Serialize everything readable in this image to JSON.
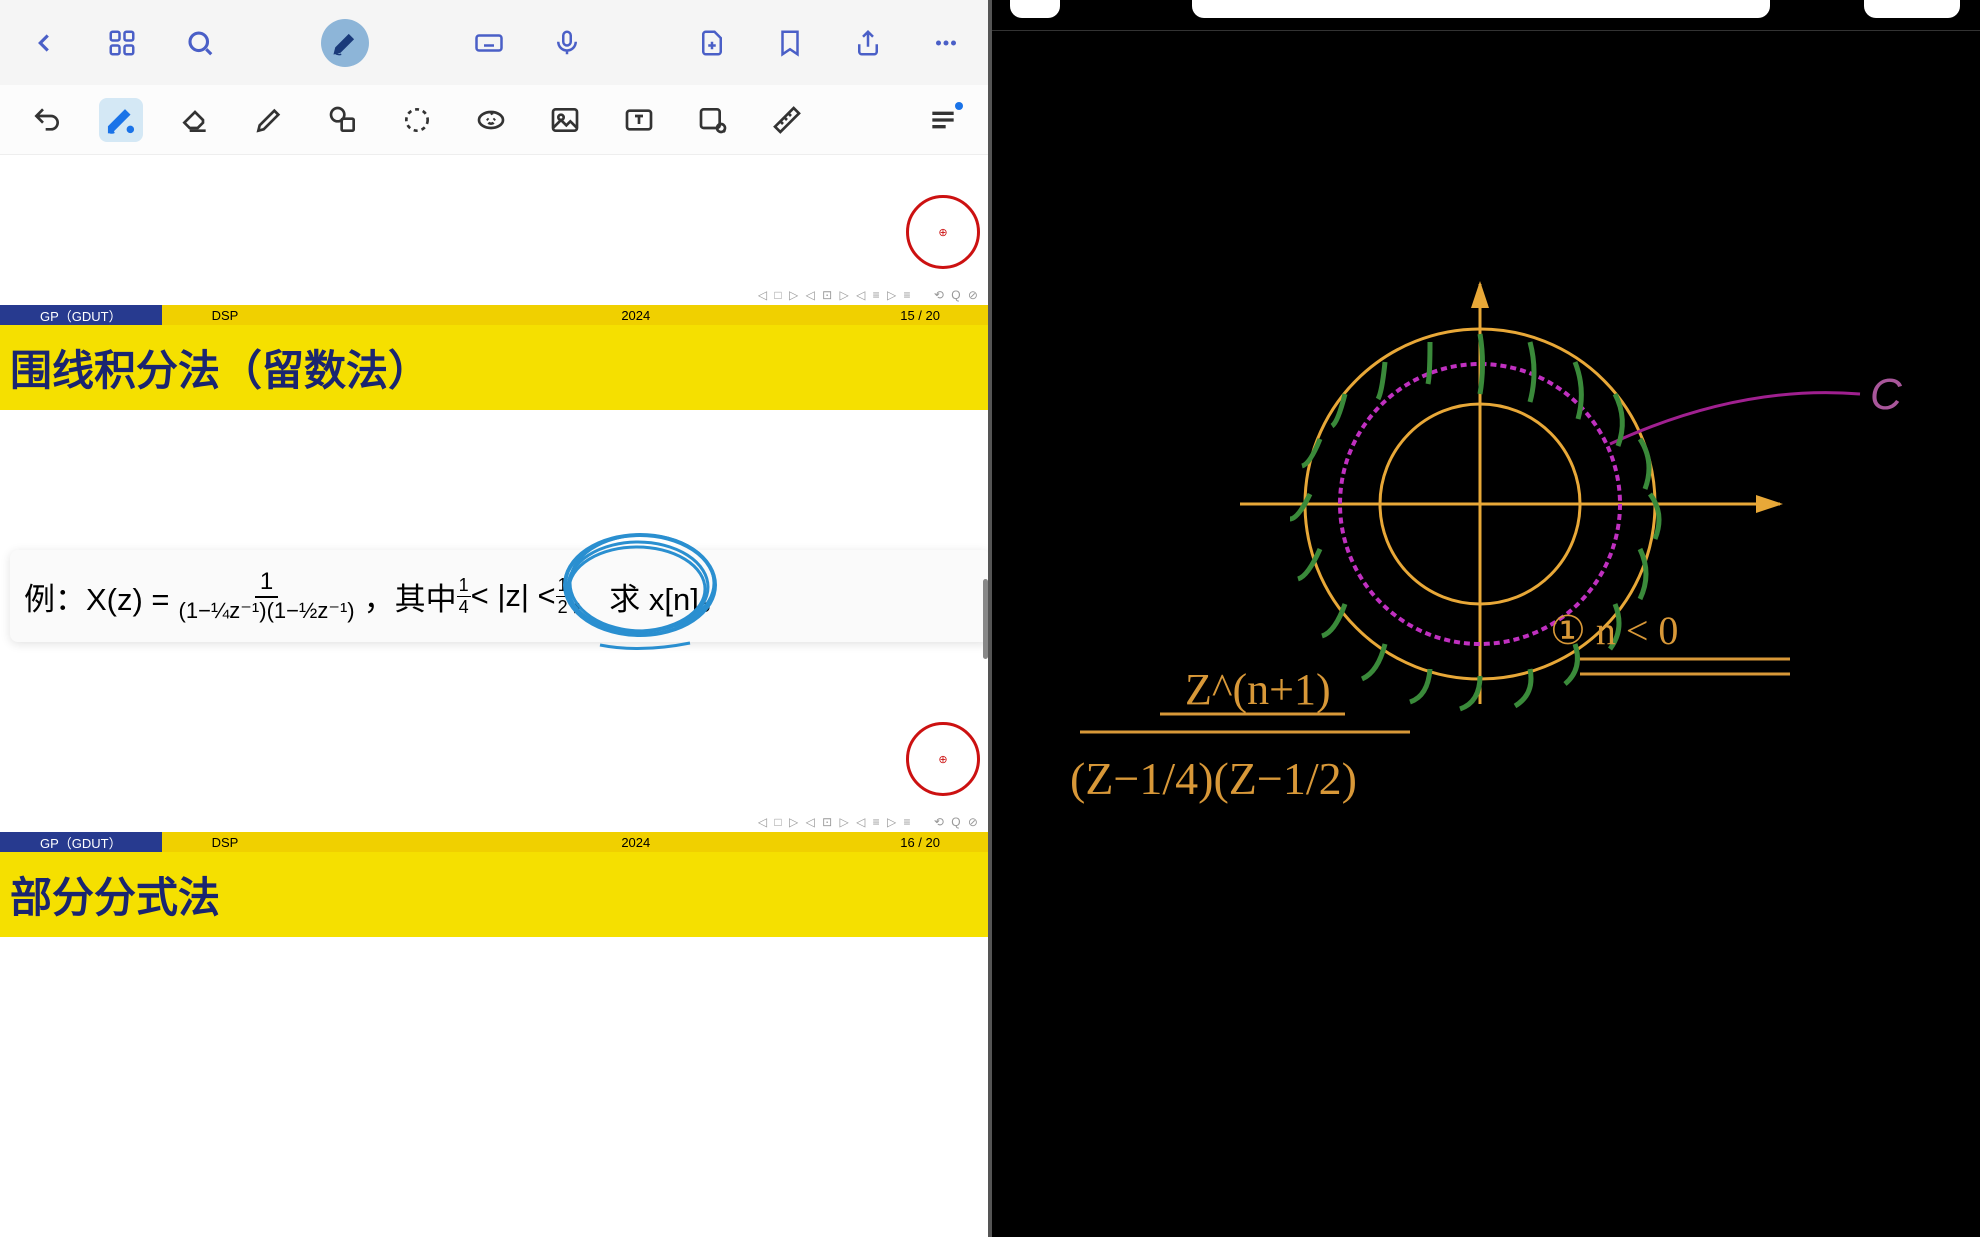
{
  "left": {
    "slide1": {
      "gp": "GP（GDUT）",
      "dsp": "DSP",
      "year": "2024",
      "page": "15 / 20"
    },
    "slide2": {
      "title": "围线积分法（留数法）",
      "gp": "GP（GDUT）",
      "dsp": "DSP",
      "year": "2024",
      "page": "16 / 20",
      "formula_prefix": "例：X(z) = ",
      "formula_num": "1",
      "formula_den": "(1−¼z⁻¹)(1−½z⁻¹)",
      "formula_mid": "，其中 ",
      "cond_left": "1",
      "cond_left_d": "4",
      "cond_mid": " < |z| < ",
      "cond_right": "1",
      "cond_right_d": "2",
      "formula_end": "， 求 x[n]。"
    },
    "slide3": {
      "title": "部分分式法"
    }
  },
  "right": {
    "label_c": "C",
    "label_case": "① n < 0",
    "expr_num": "Z^(n+1)",
    "expr_den": "(Z−1/4)(Z−1/2)"
  }
}
